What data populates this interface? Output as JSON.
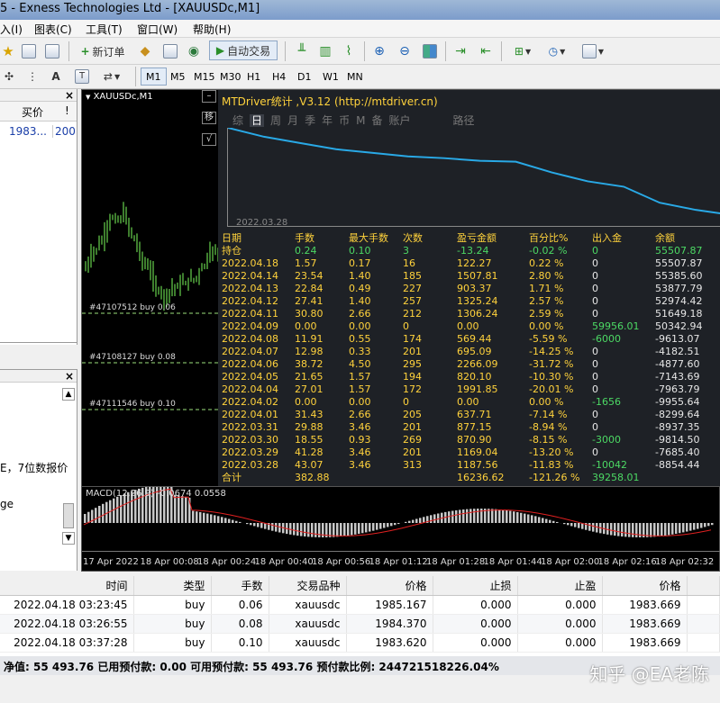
{
  "window": {
    "title": "5 - Exness Technologies Ltd - [XAUUSDc,M1]"
  },
  "menu": [
    "入(I)",
    "图表(C)",
    "工具(T)",
    "窗口(W)",
    "帮助(H)"
  ],
  "toolbar": {
    "new_order": "新订单",
    "auto_trading": "自动交易"
  },
  "timeframes": [
    "M1",
    "M5",
    "M15",
    "M30",
    "H1",
    "H4",
    "D1",
    "W1",
    "MN"
  ],
  "market_watch": {
    "col_bid": "买价",
    "col_extra": "!",
    "row_bid": "1983...",
    "row_spread": "200"
  },
  "navigator": {
    "text1": "E，7位数报价",
    "text2": "ge"
  },
  "chart": {
    "symbol": "XAUUSDc,M1",
    "order_lines": [
      "#47107512 buy 0.06",
      "#47108127 buy 0.08",
      "#47111546 buy 0.10"
    ],
    "side_buttons": [
      "–",
      "移",
      "√"
    ]
  },
  "mtdriver": {
    "title": "MTDriver统计 ,V3.12 (http://mtdriver.cn)",
    "tabs": [
      "综",
      "日",
      "周",
      "月",
      "季",
      "年",
      "币",
      "M",
      "备",
      "账户",
      "路径"
    ],
    "active_tab": "日",
    "graph_start_date": "2022.03.28",
    "headers": [
      "日期",
      "手数",
      "最大手数",
      "次数",
      "盈亏金额",
      "百分比%",
      "出入金",
      "余额"
    ],
    "rows": [
      [
        "持仓",
        "0.24",
        "0.10",
        "3",
        "-13.24",
        "-0.02 %",
        "0",
        "55507.87"
      ],
      [
        "2022.04.18",
        "1.57",
        "0.17",
        "16",
        "122.27",
        "0.22 %",
        "0",
        "55507.87"
      ],
      [
        "2022.04.14",
        "23.54",
        "1.40",
        "185",
        "1507.81",
        "2.80 %",
        "0",
        "55385.60"
      ],
      [
        "2022.04.13",
        "22.84",
        "0.49",
        "227",
        "903.37",
        "1.71 %",
        "0",
        "53877.79"
      ],
      [
        "2022.04.12",
        "27.41",
        "1.40",
        "257",
        "1325.24",
        "2.57 %",
        "0",
        "52974.42"
      ],
      [
        "2022.04.11",
        "30.80",
        "2.66",
        "212",
        "1306.24",
        "2.59 %",
        "0",
        "51649.18"
      ],
      [
        "2022.04.09",
        "0.00",
        "0.00",
        "0",
        "0.00",
        "0.00 %",
        "59956.01",
        "50342.94"
      ],
      [
        "2022.04.08",
        "11.91",
        "0.55",
        "174",
        "569.44",
        "-5.59 %",
        "-6000",
        "-9613.07"
      ],
      [
        "2022.04.07",
        "12.98",
        "0.33",
        "201",
        "695.09",
        "-14.25 %",
        "0",
        "-4182.51"
      ],
      [
        "2022.04.06",
        "38.72",
        "4.50",
        "295",
        "2266.09",
        "-31.72 %",
        "0",
        "-4877.60"
      ],
      [
        "2022.04.05",
        "21.65",
        "1.57",
        "194",
        "820.10",
        "-10.30 %",
        "0",
        "-7143.69"
      ],
      [
        "2022.04.04",
        "27.01",
        "1.57",
        "172",
        "1991.85",
        "-20.01 %",
        "0",
        "-7963.79"
      ],
      [
        "2022.04.02",
        "0.00",
        "0.00",
        "0",
        "0.00",
        "0.00 %",
        "-1656",
        "-9955.64"
      ],
      [
        "2022.04.01",
        "31.43",
        "2.66",
        "205",
        "637.71",
        "-7.14 %",
        "0",
        "-8299.64"
      ],
      [
        "2022.03.31",
        "29.88",
        "3.46",
        "201",
        "877.15",
        "-8.94 %",
        "0",
        "-8937.35"
      ],
      [
        "2022.03.30",
        "18.55",
        "0.93",
        "269",
        "870.90",
        "-8.15 %",
        "-3000",
        "-9814.50"
      ],
      [
        "2022.03.29",
        "41.28",
        "3.46",
        "201",
        "1169.04",
        "-13.20 %",
        "0",
        "-7685.40"
      ],
      [
        "2022.03.28",
        "43.07",
        "3.46",
        "313",
        "1187.56",
        "-11.83 %",
        "-10042",
        "-8854.44"
      ],
      [
        "合计",
        "382.88",
        "",
        "",
        "16236.62",
        "-121.26 %",
        "39258.01",
        ""
      ]
    ],
    "colors": {
      "date": "#ffd23c",
      "value": "#ffd23c",
      "green": "#4cd964",
      "white": "#e6e6e6",
      "graph_line": "#29a9e6"
    }
  },
  "macd": {
    "label": "MACD(12,26,9) -0.0674 0.0558"
  },
  "time_axis": [
    "17 Apr 2022",
    "18 Apr 00:08",
    "18 Apr 00:24",
    "18 Apr 00:40",
    "18 Apr 00:56",
    "18 Apr 01:12",
    "18 Apr 01:28",
    "18 Apr 01:44",
    "18 Apr 02:00",
    "18 Apr 02:16",
    "18 Apr 02:32"
  ],
  "terminal": {
    "headers": [
      "时间",
      "类型",
      "手数",
      "交易品种",
      "价格",
      "止损",
      "止盈",
      "价格"
    ],
    "rows": [
      [
        "2022.04.18 03:23:45",
        "buy",
        "0.06",
        "xauusdc",
        "1985.167",
        "0.000",
        "0.000",
        "1983.669"
      ],
      [
        "2022.04.18 03:26:55",
        "buy",
        "0.08",
        "xauusdc",
        "1984.370",
        "0.000",
        "0.000",
        "1983.669"
      ],
      [
        "2022.04.18 03:37:28",
        "buy",
        "0.10",
        "xauusdc",
        "1983.620",
        "0.000",
        "0.000",
        "1983.669"
      ]
    ]
  },
  "status": {
    "text": "净值: 55 493.76  已用预付款: 0.00  可用预付款: 55 493.76  预付款比例: 244721518226.04%"
  },
  "watermark": "知乎 @EA老陈"
}
